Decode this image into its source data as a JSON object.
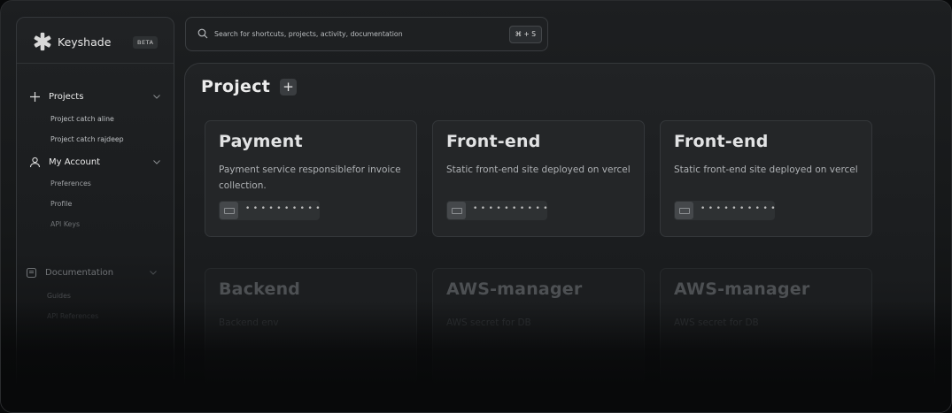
{
  "brand": {
    "name": "Keyshade",
    "badge": "BETA"
  },
  "sidebar": {
    "sections": [
      {
        "label": "Projects",
        "icon": "plus-icon",
        "items": [
          "Project catch aline",
          "Project catch rajdeep"
        ]
      },
      {
        "label": "My Account",
        "icon": "user-icon",
        "items": [
          "Preferences",
          "Profile",
          "API Keys"
        ]
      },
      {
        "label": "Documentation",
        "icon": "book-icon",
        "items": [
          "Guides",
          "API References"
        ]
      }
    ]
  },
  "search": {
    "placeholder": "Search for shortcuts, projects, activity, documentation",
    "shortcut": "⌘ + S"
  },
  "main": {
    "title": "Project",
    "add_label": "+",
    "projects": [
      {
        "title": "Payment",
        "description": "Payment service responsiblefor invoice collection.",
        "key_mask": "••••••••••"
      },
      {
        "title": "Front-end",
        "description": "Static front-end site deployed on vercel",
        "key_mask": "••••••••••"
      },
      {
        "title": "Front-end",
        "description": "Static front-end site deployed on vercel",
        "key_mask": "••••••••••"
      },
      {
        "title": "Backend",
        "description": "Backend env"
      },
      {
        "title": "AWS-manager",
        "description": "AWS secret for DB"
      },
      {
        "title": "AWS-manager",
        "description": "AWS secret for DB"
      }
    ]
  },
  "colors": {
    "background": "#08090a",
    "panel": "#1d1f21",
    "card": "#242628",
    "border": "#34373a"
  }
}
